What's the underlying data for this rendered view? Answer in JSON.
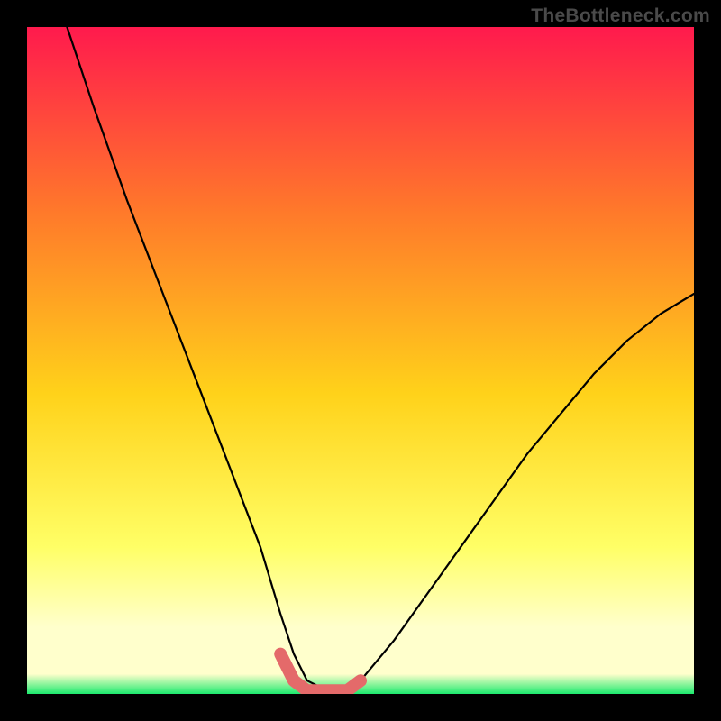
{
  "watermark": "TheBottleneck.com",
  "colors": {
    "bg": "#000000",
    "gradient_top": "#ff1a4d",
    "gradient_mid_upper": "#ff7a2a",
    "gradient_mid": "#ffd21a",
    "gradient_mid_lower": "#ffff66",
    "gradient_pale": "#ffffcc",
    "gradient_bottom": "#1cea6e",
    "curve": "#000000",
    "highlight": "#e46a6a"
  },
  "chart_data": {
    "type": "line",
    "title": "",
    "xlabel": "",
    "ylabel": "",
    "xlim": [
      0,
      100
    ],
    "ylim": [
      0,
      100
    ],
    "series": [
      {
        "name": "bottleneck-curve",
        "x": [
          6,
          10,
          15,
          20,
          25,
          30,
          35,
          38,
          40,
          42,
          45,
          48,
          50,
          55,
          60,
          65,
          70,
          75,
          80,
          85,
          90,
          95,
          100
        ],
        "y": [
          100,
          88,
          74,
          61,
          48,
          35,
          22,
          12,
          6,
          2,
          0.5,
          0.5,
          2,
          8,
          15,
          22,
          29,
          36,
          42,
          48,
          53,
          57,
          60
        ]
      },
      {
        "name": "ideal-zone-highlight",
        "x": [
          38,
          40,
          42,
          45,
          48,
          50
        ],
        "y": [
          6,
          2,
          0.5,
          0.5,
          0.5,
          2
        ]
      }
    ],
    "annotations": []
  }
}
